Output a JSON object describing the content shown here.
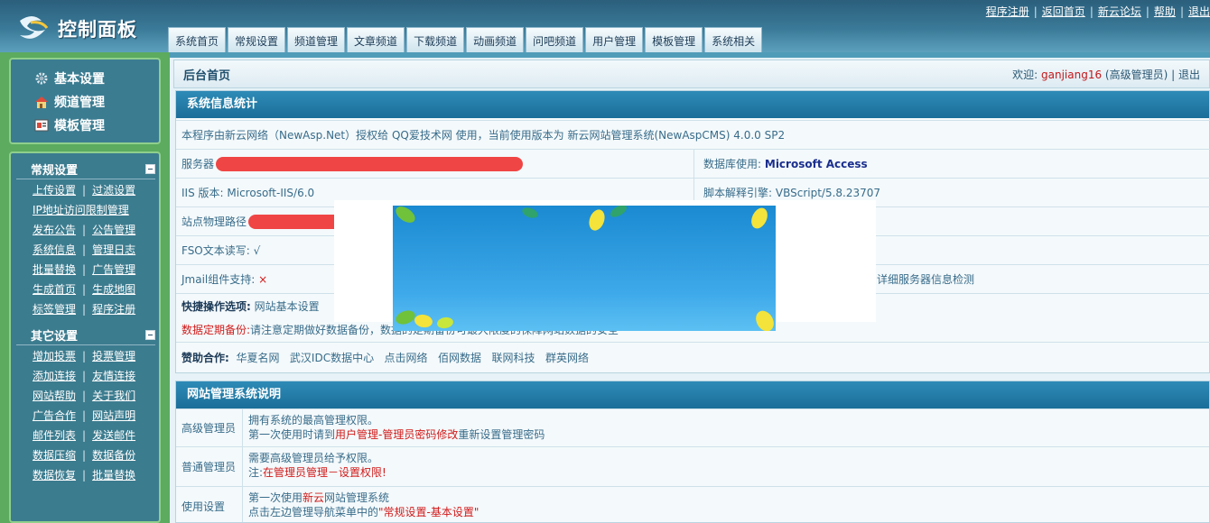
{
  "header": {
    "title": "控制面板",
    "top_links": [
      "程序注册",
      "返回首页",
      "新云论坛",
      "帮助",
      "退出"
    ],
    "tabs": [
      "系统首页",
      "常规设置",
      "频道管理",
      "文章频道",
      "下载频道",
      "动画频道",
      "问吧频道",
      "用户管理",
      "模板管理",
      "系统相关"
    ]
  },
  "sidebar": {
    "top_items": [
      {
        "label": "基本设置",
        "icon": "gear-icon"
      },
      {
        "label": "频道管理",
        "icon": "house-icon"
      },
      {
        "label": "模板管理",
        "icon": "template-icon"
      }
    ],
    "groups": [
      {
        "title": "常规设置",
        "rows": [
          [
            "上传设置",
            "过滤设置"
          ],
          [
            "IP地址访问限制管理"
          ],
          [
            "发布公告",
            "公告管理"
          ],
          [
            "系统信息",
            "管理日志"
          ],
          [
            "批量替换",
            "广告管理"
          ],
          [
            "生成首页",
            "生成地图"
          ],
          [
            "标签管理",
            "程序注册"
          ]
        ]
      },
      {
        "title": "其它设置",
        "rows": [
          [
            "增加投票",
            "投票管理"
          ],
          [
            "添加连接",
            "友情连接"
          ],
          [
            "网站帮助",
            "关于我们"
          ],
          [
            "广告合作",
            "网站声明"
          ],
          [
            "邮件列表",
            "发送邮件"
          ],
          [
            "数据压缩",
            "数据备份"
          ],
          [
            "数据恢复",
            "批量替换"
          ]
        ]
      }
    ]
  },
  "main": {
    "crumb": "后台首页",
    "welcome_prefix": "欢迎:",
    "username": "ganjiang16",
    "role": "(高级管理员)",
    "logout": "退出",
    "stats": {
      "title": "系统信息统计",
      "license": "本程序由新云网络（NewAsp.Net）授权给 QQ爱技术网 使用，当前使用版本为 新云网站管理系统(NewAspCMS) 4.0.0 SP2",
      "server_label": "服务器",
      "db_label": "数据库使用:",
      "db_value": "Microsoft Access",
      "iis_label": "IIS 版本:",
      "iis_value": "Microsoft-IIS/6.0",
      "script_label": "脚本解释引擎:",
      "script_value": "VBScript/5.8.23707",
      "path_label": "站点物理路径",
      "fso_label": "FSO文本读写:",
      "fso_value": "√",
      "jmail_label": "Jmail组件支持:",
      "jmail_value": "×",
      "detail_link": "详细服务器信息检测",
      "quick_label": "快捷操作选项:",
      "quick_value": "网站基本设置",
      "backup_label": "数据定期备份:",
      "backup_text": "请注意定期做好数据备份，数据的定期备份可最大限度的保障网站数据的安全",
      "sponsor_label": "赞助合作:",
      "sponsors": [
        "华夏名网",
        "武汉IDC数据中心",
        "点击网络",
        "佰网数据",
        "联网科技",
        "群英网络"
      ]
    },
    "guide": {
      "title": "网站管理系统说明",
      "rows": [
        {
          "label": "高级管理员",
          "line1": "拥有系统的最高管理权限。",
          "line2_a": "第一次使用时请到",
          "line2_b": "用户管理-管理员密码修改",
          "line2_c": "重新设置管理密码"
        },
        {
          "label": "普通管理员",
          "line1": "需要高级管理员给予权限。",
          "line2_a": "注:",
          "line2_b": "在管理员管理－设置权限!",
          "line2_c": ""
        },
        {
          "label": "使用设置",
          "line1_a": "第一次使用",
          "line1_b": "新云",
          "line1_c": "网站管理系统",
          "line2_a": "点击左边管理导航菜单中的",
          "line2_b": "\"常规设置-基本设置\"",
          "line2_c": ""
        }
      ]
    }
  },
  "colors": {
    "accent": "#2e8bb7",
    "sidebar_green": "#5cab5f",
    "sidebar_blue": "#3c7c8f",
    "alert": "#d11b1b"
  }
}
